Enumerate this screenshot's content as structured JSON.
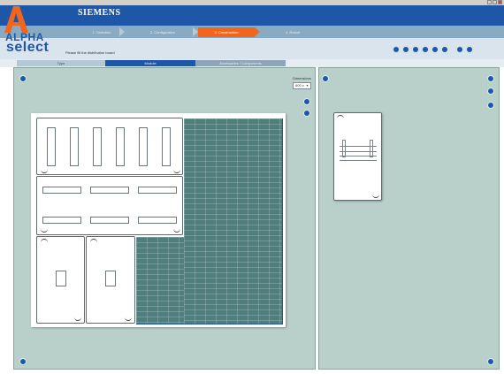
{
  "app": {
    "brand": "SIEMENS",
    "logo_line1": "ALPHA",
    "logo_line2": "select"
  },
  "steps": [
    {
      "label": "1. Selection",
      "active": false
    },
    {
      "label": "2. Configuration",
      "active": false
    },
    {
      "label": "3. Construction",
      "active": true
    },
    {
      "label": "4. Result",
      "active": false
    }
  ],
  "instruction": "Please fill the distribution board",
  "toolbar_icons": [
    "open-icon",
    "save-icon",
    "print-icon",
    "info-icon",
    "options-icon",
    "export-icon",
    "help-icon",
    "close-icon"
  ],
  "tabs": [
    {
      "label": "Type",
      "active": false
    },
    {
      "label": "Module",
      "active": true
    },
    {
      "label": "Accessories / Components",
      "active": false
    }
  ],
  "dimension": {
    "label": "Dimensions",
    "value": "600 x"
  },
  "colors": {
    "brand_blue": "#1f57a8",
    "active_step": "#f1651c",
    "panel_bg": "#b9cfc9",
    "grid_fill": "#4f7f7d"
  }
}
